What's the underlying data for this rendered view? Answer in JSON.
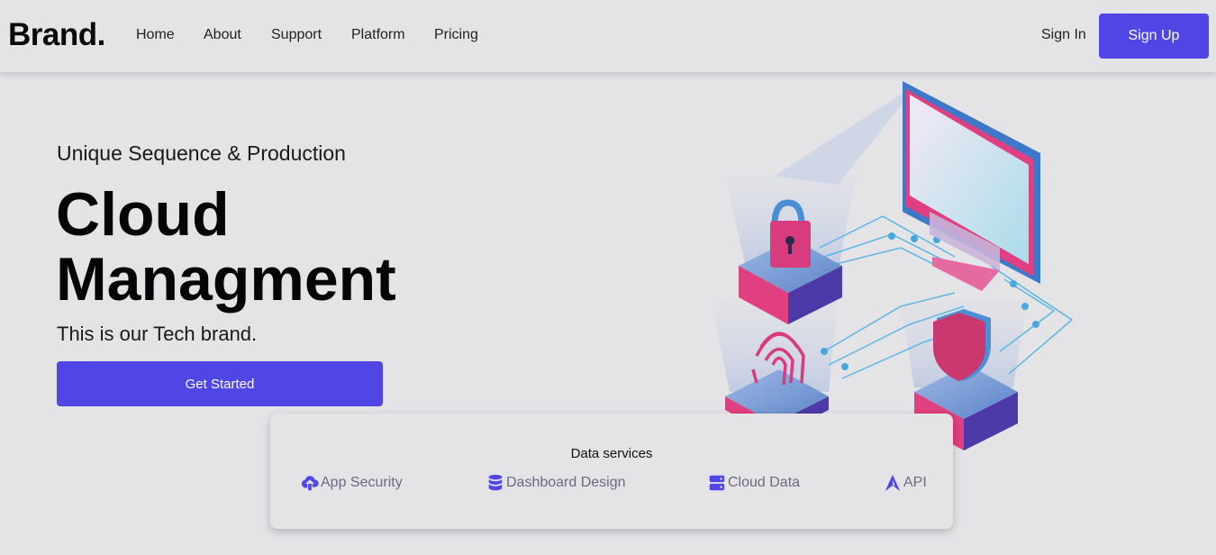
{
  "header": {
    "brand": "Brand.",
    "nav": [
      "Home",
      "About",
      "Support",
      "Platform",
      "Pricing"
    ],
    "sign_in": "Sign In",
    "sign_up": "Sign Up"
  },
  "hero": {
    "subtitle": "Unique Sequence & Production",
    "title_line1": "Cloud",
    "title_line2": "Managment",
    "description": "This is our Tech brand.",
    "cta": "Get Started"
  },
  "services": {
    "title": "Data services",
    "items": [
      {
        "label": "App Security",
        "icon": "cloud-upload-icon"
      },
      {
        "label": "Dashboard Design",
        "icon": "database-icon"
      },
      {
        "label": "Cloud Data",
        "icon": "server-icon"
      },
      {
        "label": "API",
        "icon": "api-icon"
      }
    ]
  },
  "colors": {
    "accent": "#4f46e5",
    "background": "#e4e4e7",
    "illustration_pink": "#e0407f",
    "illustration_blue": "#4a90d9"
  }
}
